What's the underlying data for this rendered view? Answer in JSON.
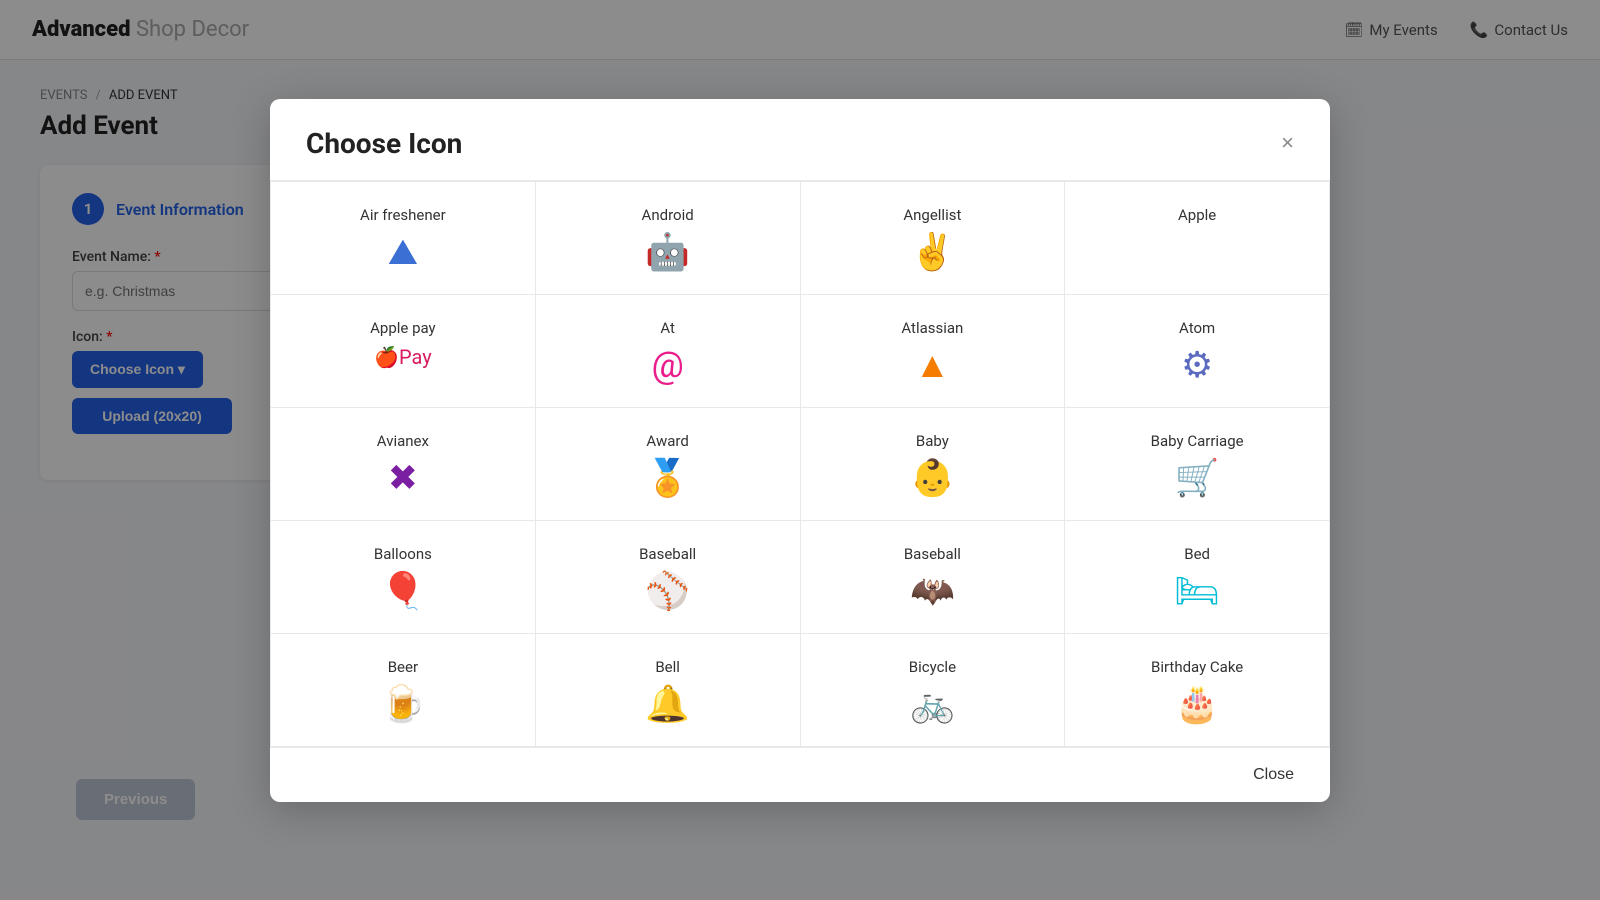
{
  "app": {
    "title_bold": "Advanced",
    "title_light": " Shop Decor"
  },
  "nav": {
    "links": [
      {
        "id": "my-events",
        "icon": "🗓",
        "label": "My Events"
      },
      {
        "id": "contact-us",
        "icon": "📞",
        "label": "Contact Us"
      }
    ]
  },
  "breadcrumb": {
    "items": [
      "EVENTS",
      "ADD EVENT"
    ]
  },
  "page": {
    "title": "Add Event"
  },
  "form": {
    "step_number": "1",
    "step_label": "Event Information",
    "event_name_label": "Event Name:",
    "event_name_placeholder": "e.g. Christmas",
    "icon_label": "Icon:",
    "choose_icon_button": "Choose Icon ▾",
    "upload_button": "Upload (20x20)"
  },
  "buttons": {
    "previous": "Previous"
  },
  "modal": {
    "title": "Choose Icon",
    "close_x": "×",
    "close_button": "Close",
    "icons": [
      {
        "id": "air-freshener",
        "name": "Air freshener",
        "symbol": "🏔",
        "color": "color-blue"
      },
      {
        "id": "android",
        "name": "Android",
        "symbol": "🤖",
        "color": "color-green"
      },
      {
        "id": "angellist",
        "name": "Angellist",
        "symbol": "✌",
        "color": "color-orange"
      },
      {
        "id": "apple",
        "name": "Apple",
        "symbol": "",
        "color": "color-black"
      },
      {
        "id": "apple-pay",
        "name": "Apple pay",
        "symbol": "⌘Pay",
        "color": "color-pink"
      },
      {
        "id": "at",
        "name": "At",
        "symbol": "@",
        "color": "color-pink"
      },
      {
        "id": "atlassian",
        "name": "Atlassian",
        "symbol": "▲",
        "color": "color-orange"
      },
      {
        "id": "atom",
        "name": "Atom",
        "symbol": "⚙",
        "color": "color-blue"
      },
      {
        "id": "avianex",
        "name": "Avianex",
        "symbol": "✖",
        "color": "color-purple"
      },
      {
        "id": "award",
        "name": "Award",
        "symbol": "🏅",
        "color": "color-green"
      },
      {
        "id": "baby",
        "name": "Baby",
        "symbol": "👶",
        "color": "color-purple"
      },
      {
        "id": "baby-carriage",
        "name": "Baby Carriage",
        "symbol": "🛒",
        "color": "color-orange"
      },
      {
        "id": "balloons",
        "name": "Balloons",
        "symbol": "🎈",
        "color": "color-red"
      },
      {
        "id": "baseball-ball",
        "name": "Baseball",
        "symbol": "⚾",
        "color": "color-red"
      },
      {
        "id": "baseball-bat",
        "name": "Baseball",
        "symbol": "🦇",
        "color": "color-purple"
      },
      {
        "id": "bed",
        "name": "Bed",
        "symbol": "🛏",
        "color": "color-cyan"
      },
      {
        "id": "beer",
        "name": "Beer",
        "symbol": "🍺",
        "color": "color-orange"
      },
      {
        "id": "bell",
        "name": "Bell",
        "symbol": "🔔",
        "color": "color-pink"
      },
      {
        "id": "bicycle",
        "name": "Bicycle",
        "symbol": "🚲",
        "color": "color-purple"
      },
      {
        "id": "birthday-cake",
        "name": "Birthday Cake",
        "symbol": "🎂",
        "color": "color-pink"
      }
    ]
  }
}
